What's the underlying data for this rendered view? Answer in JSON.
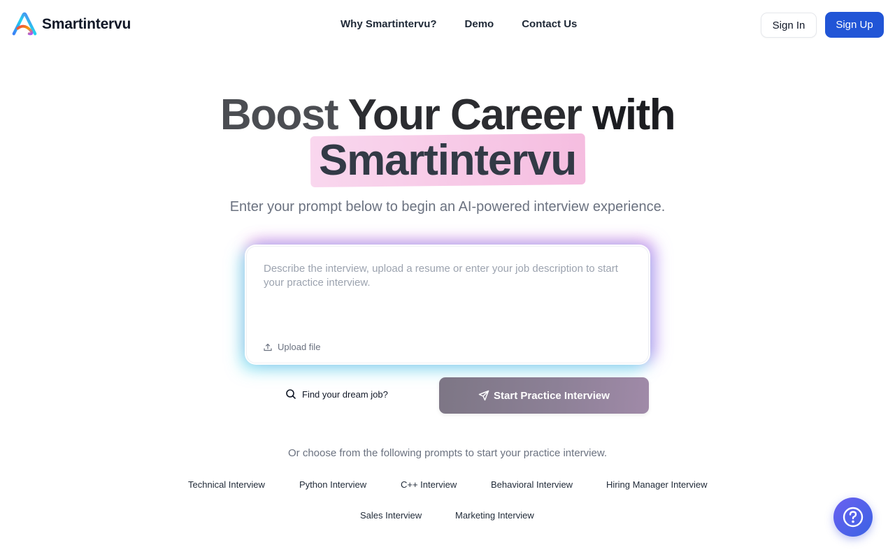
{
  "header": {
    "brand": "Smartintervu",
    "nav": [
      "Why Smartintervu?",
      "Demo",
      "Contact Us"
    ],
    "sign_in": "Sign In",
    "sign_up": "Sign Up"
  },
  "hero": {
    "line1_a": "Boost ",
    "line1_b": "Your Career ",
    "line1_c": "with",
    "line2": "Smartintervu",
    "subtitle": "Enter your prompt below to begin an AI-powered interview experience."
  },
  "prompt_box": {
    "placeholder": "Describe the interview, upload a resume or enter your job description to start your practice interview.",
    "value": "",
    "upload_label": "Upload file"
  },
  "actions": {
    "find_job": "Find your dream job?",
    "start": "Start Practice Interview"
  },
  "prompts": {
    "title": "Or choose from the following prompts to start your practice interview.",
    "items": [
      "Technical Interview",
      "Python Interview",
      "C++ Interview",
      "Behavioral Interview",
      "Hiring Manager Interview",
      "Sales Interview",
      "Marketing Interview"
    ]
  },
  "icons": {
    "logo": "smartintervu-logo",
    "upload": "upload-icon",
    "search": "search-icon",
    "send": "send-icon",
    "help": "help-icon"
  },
  "colors": {
    "primary": "#2155d6",
    "highlight": "#f7c8e6",
    "help_gradient_start": "#6a60f0",
    "help_gradient_end": "#3b63e4"
  }
}
